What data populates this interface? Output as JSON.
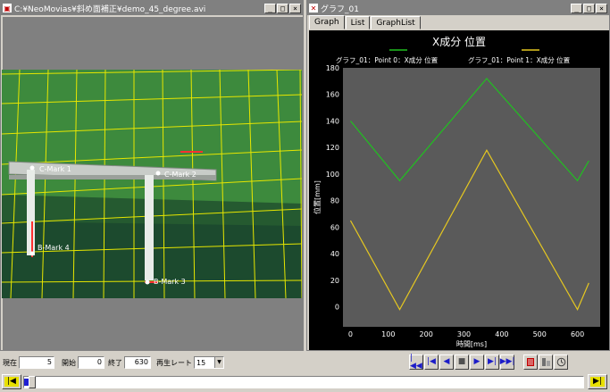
{
  "video_window": {
    "title": "C:¥NeoMovias¥斜め面補正¥demo_45_degree.avi",
    "buttons": {
      "minimize": "_",
      "maximize": "□",
      "close": "×"
    },
    "markers": [
      {
        "label": "C-Mark 1",
        "color": "#ffffff"
      },
      {
        "label": "C-Mark 2",
        "color": "#ffffff"
      },
      {
        "label": "B-Mark 4",
        "color": "#ffffff"
      },
      {
        "label": "B-Mark 3",
        "color": "#ffffff"
      }
    ],
    "colors": {
      "background": "#3a7a3a",
      "grid": "#e6e600",
      "frame": "#808080"
    }
  },
  "graph_window": {
    "title": "グラフ_01",
    "buttons": {
      "minimize": "_",
      "maximize": "□",
      "close": "×"
    },
    "tabs": [
      {
        "label": "Graph",
        "active": true
      },
      {
        "label": "List",
        "active": false
      },
      {
        "label": "GraphList",
        "active": false
      }
    ]
  },
  "chart_data": {
    "type": "line",
    "title": "X成分 位置",
    "xlabel": "時間[ms]",
    "ylabel": "位置[mm]",
    "xlim": [
      -20,
      660
    ],
    "ylim": [
      -15,
      180
    ],
    "xticks": [
      0,
      100,
      200,
      300,
      400,
      500,
      600
    ],
    "yticks": [
      0,
      20,
      40,
      60,
      80,
      100,
      120,
      140,
      160,
      180
    ],
    "grid": false,
    "legend_position": "top",
    "series": [
      {
        "name": "グラフ_01：Point 0：X成分 位置",
        "color": "#20c020",
        "x": [
          0,
          130,
          360,
          600,
          630
        ],
        "y": [
          140,
          95,
          172,
          95,
          110
        ]
      },
      {
        "name": "グラフ_01：Point 1：X成分 位置",
        "color": "#e6c820",
        "x": [
          0,
          130,
          360,
          600,
          630
        ],
        "y": [
          65,
          -2,
          118,
          -2,
          18
        ]
      }
    ]
  },
  "toolbar": {
    "current_label": "現在",
    "current_value": "5",
    "start_label": "開始",
    "start_value": "0",
    "end_label": "終了",
    "end_value": "630",
    "rate_label": "再生レート",
    "rate_value": "15",
    "controls": [
      {
        "name": "go-first",
        "glyph": "|◀◀"
      },
      {
        "name": "step-back-frame",
        "glyph": "|◀"
      },
      {
        "name": "play-reverse",
        "glyph": "◀"
      },
      {
        "name": "stop",
        "glyph": "■"
      },
      {
        "name": "play-forward",
        "glyph": "▶"
      },
      {
        "name": "step-forward-frame",
        "glyph": "▶|"
      },
      {
        "name": "go-last",
        "glyph": "▶▶|"
      }
    ]
  },
  "seekbar": {
    "left_glyph": "|◀",
    "right_glyph": "▶|",
    "position_fraction": 0.008
  }
}
